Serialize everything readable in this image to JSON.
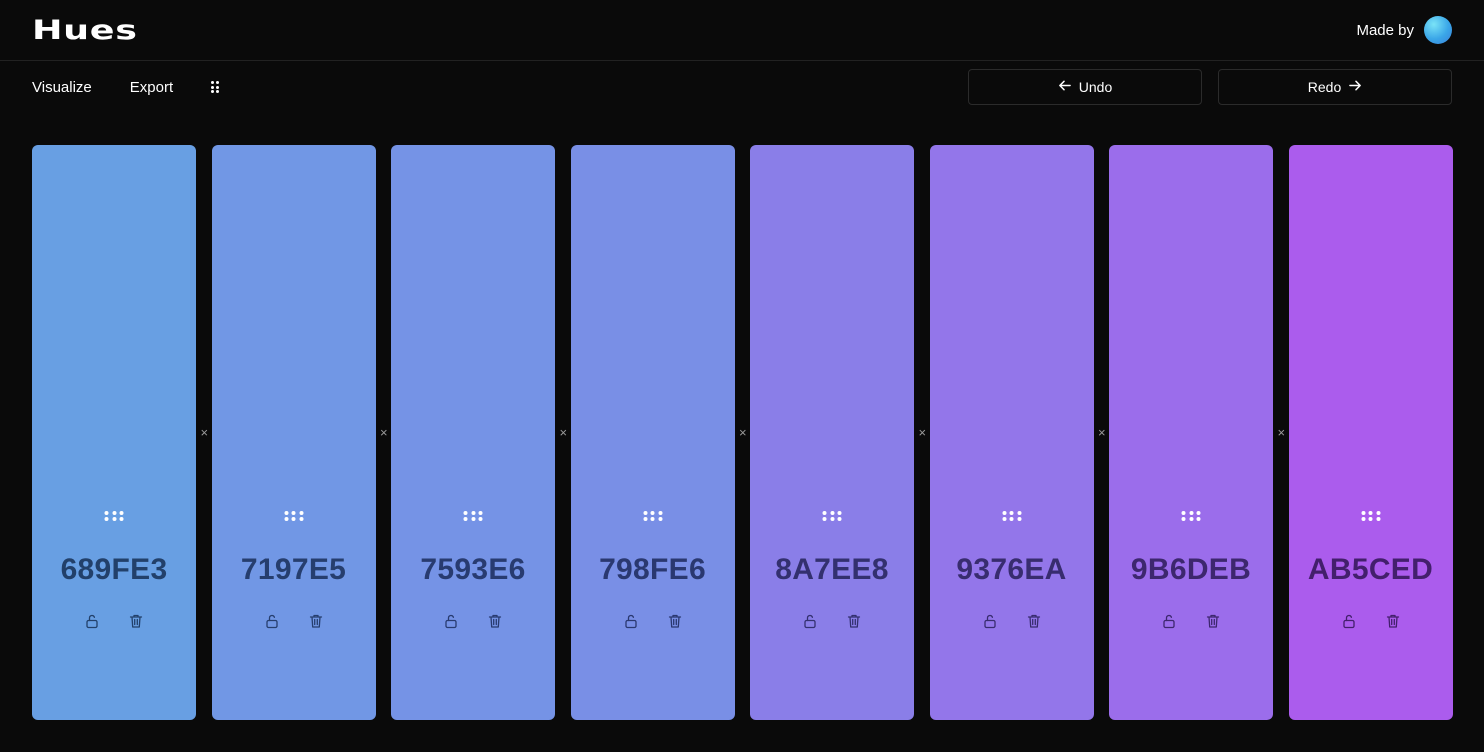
{
  "header": {
    "logo": "Hues",
    "made_by": "Made by"
  },
  "toolbar": {
    "visualize": "Visualize",
    "export": "Export",
    "undo": "Undo",
    "redo": "Redo"
  },
  "icons": {
    "grip": "grip-vertical-icon",
    "undo": "arrow-left-icon",
    "redo": "arrow-right-icon",
    "drag": "drag-dots-icon",
    "lock": "unlock-icon",
    "delete": "trash-icon",
    "separator": "close-icon"
  },
  "separator_glyph": "×",
  "swatches": [
    {
      "hex": "689FE3",
      "bg": "#689FE3",
      "fg": "#22406a"
    },
    {
      "hex": "7197E5",
      "bg": "#7197E5",
      "fg": "#263e6e"
    },
    {
      "hex": "7593E6",
      "bg": "#7593E6",
      "fg": "#283b70"
    },
    {
      "hex": "798FE6",
      "bg": "#798FE6",
      "fg": "#2a3870"
    },
    {
      "hex": "8A7EE8",
      "bg": "#8A7EE8",
      "fg": "#33306f"
    },
    {
      "hex": "9376EA",
      "bg": "#9376EA",
      "fg": "#382c6f"
    },
    {
      "hex": "9B6DEB",
      "bg": "#9B6DEB",
      "fg": "#3d276e"
    },
    {
      "hex": "AB5CED",
      "bg": "#AB5CED",
      "fg": "#431f6c"
    }
  ]
}
